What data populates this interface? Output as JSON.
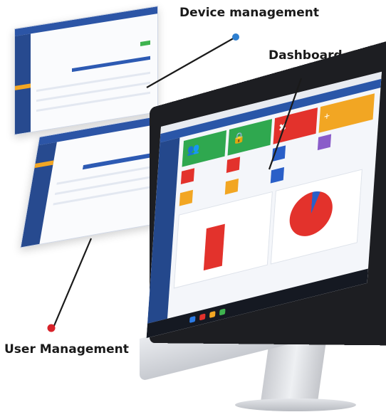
{
  "callouts": {
    "device": "Device management",
    "dashboard": "Dashboard",
    "user": "User Management"
  },
  "colors": {
    "sidebar": "#274a8f",
    "header": "#2c55a6",
    "accent_orange": "#f2a623",
    "accent_green": "#3fb34f",
    "accent_red": "#e3322c",
    "pointer_blue": "#2e7fd0",
    "pointer_red": "#d8232a"
  },
  "icons": {
    "tile1": "users-icon",
    "tile2": "lock-icon",
    "tile3": "user-delete-icon",
    "tile4": "user-add-icon",
    "tile5": "cart-icon",
    "tile6": "device-icon"
  },
  "dashboard_chart": {
    "bar_fraction": 0.72,
    "pie_red_percent": 94
  }
}
